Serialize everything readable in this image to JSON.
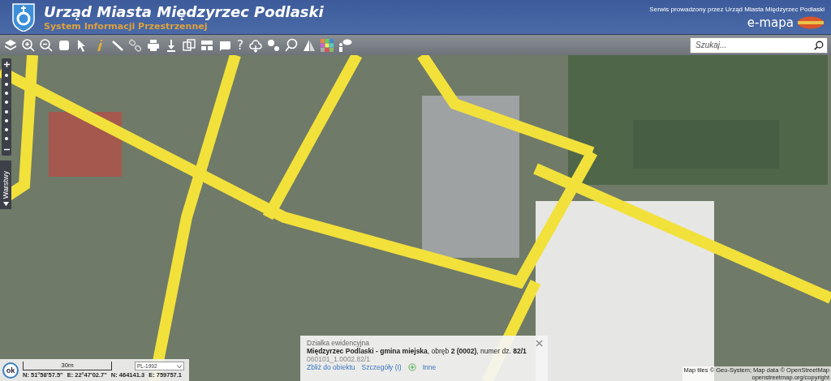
{
  "header": {
    "title": "Urząd Miasta Międzyrzec Podlaski",
    "subtitle": "System Informacji Przestrzennej",
    "operator_note": "Serwis prowadzony przez Urząd Miasta Międzyrzec Podlaski",
    "brand": "e-mapa"
  },
  "toolbar": {
    "help_glyph": "?"
  },
  "search": {
    "placeholder": "Szukaj..."
  },
  "layers_tab": {
    "label": "Warstwy"
  },
  "info_popup": {
    "title": "Działka ewidencyjna",
    "description": "**Międzyrzec Podlaski - gmina miejska**, obręb **2 (0002)**, numer dz. **82/1**",
    "identifier": "060101_1.0002.82/1",
    "links": [
      "Zbliż do obiektu",
      "Szczegóły (I)"
    ],
    "more_link": "Inne"
  },
  "status_panel": {
    "ok_button": "ok",
    "scale_label": "30m",
    "projection": "PL-1992",
    "coordinates": [
      "N: 51°58'57.5\"",
      "E: 22°47'02.7\"",
      "N: 464141.3",
      "E: 759757.1"
    ]
  },
  "attribution": [
    "Map tiles © Geo-System; Map data © OpenStreetMap",
    "openstreetmap.org/copyright"
  ]
}
